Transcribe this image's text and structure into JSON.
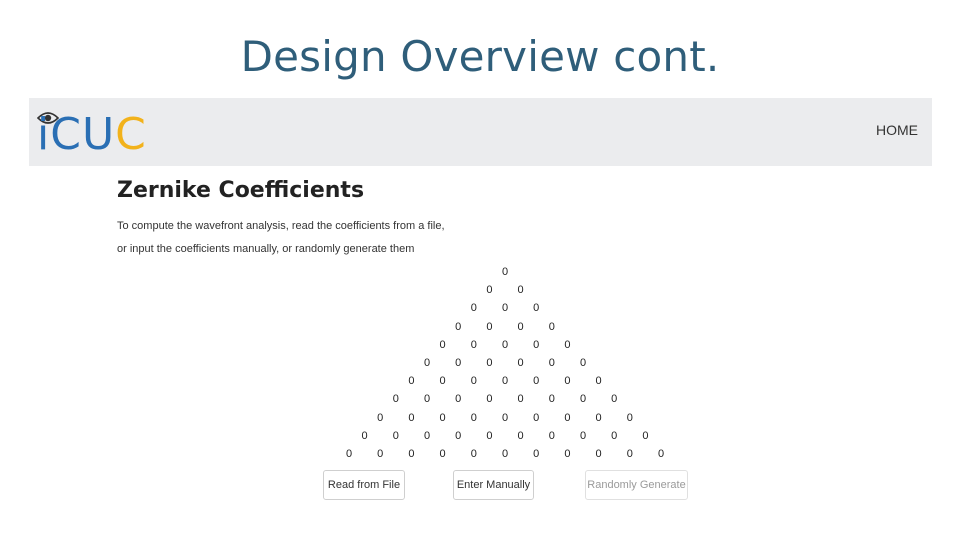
{
  "slide": {
    "title": "Design Overview cont."
  },
  "navbar": {
    "logo": {
      "letters": [
        "i",
        "CU",
        "C"
      ]
    },
    "home_label": "HOME"
  },
  "page": {
    "heading": "Zernike Coefficients",
    "description_line1": "To compute the wavefront analysis, read the coefficients from a file,",
    "description_line2": "or input the coefficients manually, or randomly generate them"
  },
  "coefficients": [
    [
      0
    ],
    [
      0,
      0
    ],
    [
      0,
      0,
      0
    ],
    [
      0,
      0,
      0,
      0
    ],
    [
      0,
      0,
      0,
      0,
      0
    ],
    [
      0,
      0,
      0,
      0,
      0,
      0
    ],
    [
      0,
      0,
      0,
      0,
      0,
      0,
      0
    ],
    [
      0,
      0,
      0,
      0,
      0,
      0,
      0,
      0
    ],
    [
      0,
      0,
      0,
      0,
      0,
      0,
      0,
      0,
      0
    ],
    [
      0,
      0,
      0,
      0,
      0,
      0,
      0,
      0,
      0,
      0
    ],
    [
      0,
      0,
      0,
      0,
      0,
      0,
      0,
      0,
      0,
      0,
      0
    ]
  ],
  "buttons": {
    "read_from_file": "Read from File",
    "enter_manually": "Enter Manually",
    "randomly_generate": "Randomly Generate"
  }
}
